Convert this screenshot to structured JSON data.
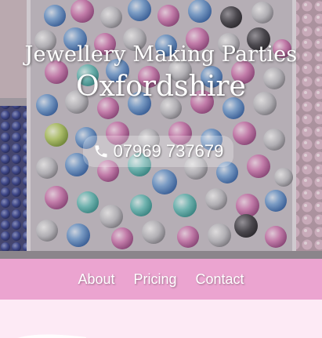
{
  "hero": {
    "title_line1": "Jewellery Making Parties",
    "title_line2": "Oxfordshire",
    "phone": {
      "icon": "phone-icon",
      "number": "07969 737679"
    }
  },
  "nav": {
    "items": [
      {
        "label": "About"
      },
      {
        "label": "Pricing"
      },
      {
        "label": "Contact"
      }
    ]
  },
  "colors": {
    "nav_background": "#eba4d0",
    "page_background": "#fdeaf5",
    "text": "#ffffff"
  }
}
